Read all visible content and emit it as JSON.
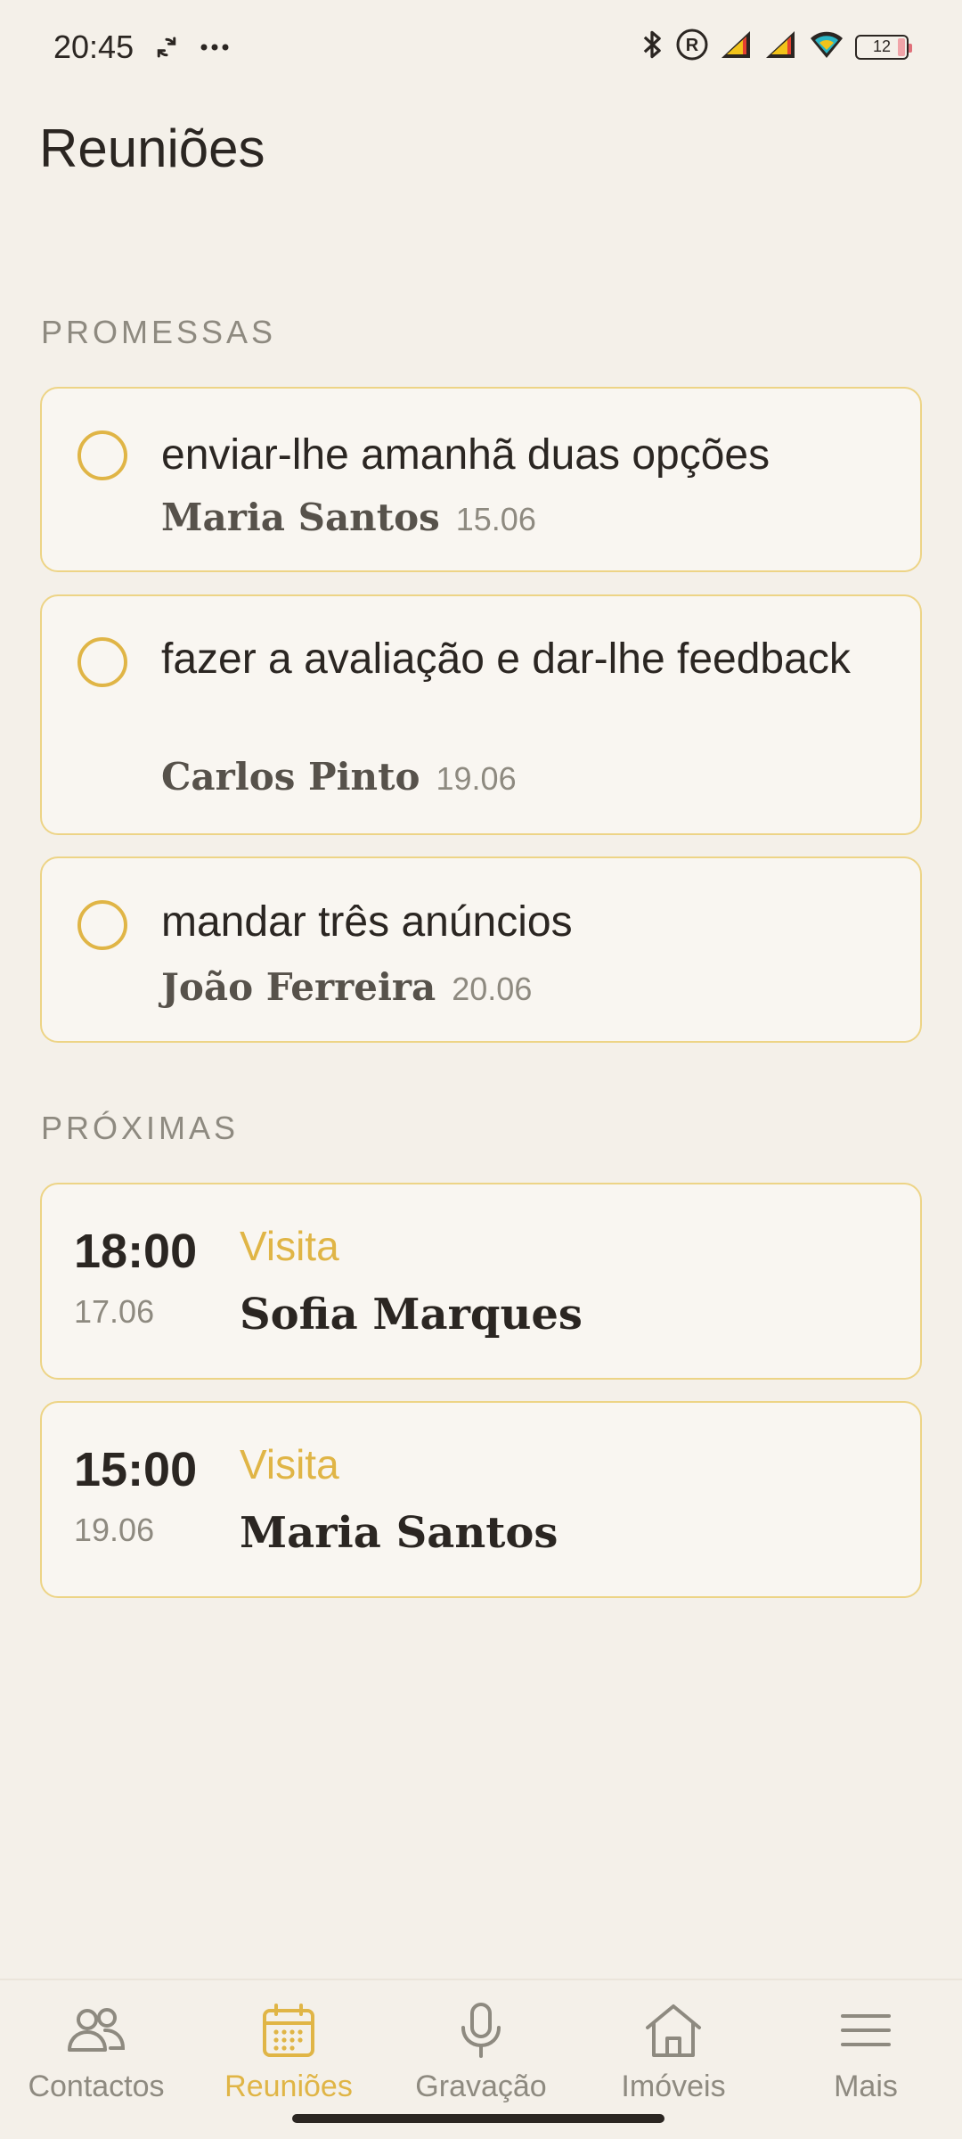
{
  "status": {
    "time": "20:45",
    "battery": "12",
    "sync_icon": "sync-icon",
    "more_icon": "more-dots-icon"
  },
  "page": {
    "title": "Reuniões"
  },
  "promises": {
    "section_label": "PROMESSAS",
    "items": [
      {
        "text": "enviar-lhe amanhã duas opções",
        "person": "Maria Santos",
        "date": "15.06"
      },
      {
        "text": "fazer a avaliação e dar-lhe feedback",
        "person": "Carlos Pinto",
        "date": "19.06"
      },
      {
        "text": "mandar três anúncios",
        "person": "João Ferreira",
        "date": "20.06"
      }
    ]
  },
  "upcoming": {
    "section_label": "PRÓXIMAS",
    "items": [
      {
        "time": "18:00",
        "date": "17.06",
        "type": "Visita",
        "person": "Sofia Marques"
      },
      {
        "time": "15:00",
        "date": "19.06",
        "type": "Visita",
        "person": "Maria Santos"
      }
    ]
  },
  "nav": {
    "active": "Reuniões",
    "items": [
      {
        "label": "Contactos",
        "icon": "contacts-icon"
      },
      {
        "label": "Reuniões",
        "icon": "calendar-icon"
      },
      {
        "label": "Gravação",
        "icon": "microphone-icon"
      },
      {
        "label": "Imóveis",
        "icon": "house-icon"
      },
      {
        "label": "Mais",
        "icon": "menu-icon"
      }
    ]
  },
  "colors": {
    "accent": "#e0b546",
    "card_border": "#edd486",
    "background": "#f4f0e9",
    "card_background": "#f9f6f1",
    "muted_text": "#8e8a80"
  }
}
